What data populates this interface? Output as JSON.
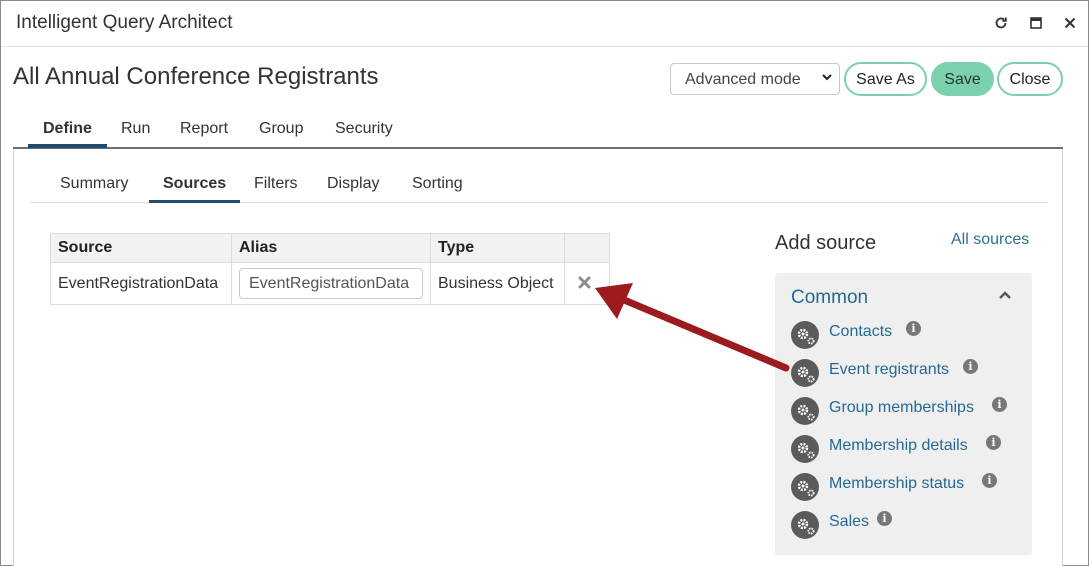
{
  "window": {
    "title": "Intelligent Query Architect"
  },
  "page": {
    "title": "All Annual Conference Registrants"
  },
  "toolbar": {
    "mode_selected": "Advanced mode",
    "save_as_label": "Save As",
    "save_label": "Save",
    "close_label": "Close"
  },
  "main_tabs": [
    {
      "label": "Define",
      "active": true
    },
    {
      "label": "Run"
    },
    {
      "label": "Report"
    },
    {
      "label": "Group"
    },
    {
      "label": "Security"
    }
  ],
  "sub_tabs": [
    {
      "label": "Summary"
    },
    {
      "label": "Sources",
      "active": true
    },
    {
      "label": "Filters"
    },
    {
      "label": "Display"
    },
    {
      "label": "Sorting"
    }
  ],
  "sources_table": {
    "headers": [
      "Source",
      "Alias",
      "Type"
    ],
    "rows": [
      {
        "source": "EventRegistrationData",
        "alias": "EventRegistrationData",
        "type": "Business Object"
      }
    ]
  },
  "add_source": {
    "title": "Add source",
    "all_sources_label": "All sources",
    "group_title": "Common",
    "items": [
      {
        "label": "Contacts"
      },
      {
        "label": "Event registrants"
      },
      {
        "label": "Group memberships"
      },
      {
        "label": "Membership details"
      },
      {
        "label": "Membership status"
      },
      {
        "label": "Sales"
      }
    ]
  },
  "colors": {
    "accent_green": "#7bd0ad",
    "link_blue": "#256994",
    "tab_underline": "#1e4b6e",
    "arrow_red": "#9b1b1f"
  }
}
